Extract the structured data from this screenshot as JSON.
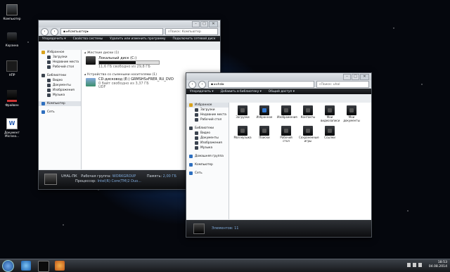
{
  "desktop": {
    "icons": [
      {
        "label": "Компьютер",
        "icon": "computer-icon"
      },
      {
        "label": "Корзина",
        "icon": "recycle-bin-icon"
      },
      {
        "label": "НПР",
        "icon": "shortcut-icon"
      },
      {
        "label": "Фрайвен",
        "icon": "shortcut-icon"
      },
      {
        "label": "Документ Microso...",
        "icon": "word-document-icon"
      }
    ]
  },
  "win1": {
    "path": "Компьютер",
    "search_placeholder": "Поиск: Компьютер",
    "toolbar": [
      "Упорядочить ▾",
      "Свойства системы",
      "Удалить или изменить программу",
      "Подключить сетевой диск"
    ],
    "nav": [
      {
        "label": "Избранное",
        "icon": "star-icon",
        "sub": false
      },
      {
        "label": "Загрузки",
        "icon": "folder-icon",
        "sub": true
      },
      {
        "label": "Недавние места",
        "icon": "folder-icon",
        "sub": true
      },
      {
        "label": "Рабочий стол",
        "icon": "folder-icon",
        "sub": true
      },
      {
        "label": "Библиотеки",
        "icon": "library-icon",
        "sub": false
      },
      {
        "label": "Видео",
        "icon": "folder-icon",
        "sub": true
      },
      {
        "label": "Документы",
        "icon": "folder-icon",
        "sub": true
      },
      {
        "label": "Изображения",
        "icon": "folder-icon",
        "sub": true
      },
      {
        "label": "Музыка",
        "icon": "folder-icon",
        "sub": true
      },
      {
        "label": "Компьютер",
        "icon": "computer-icon",
        "sub": false,
        "selected": true
      },
      {
        "label": "Сеть",
        "icon": "network-icon",
        "sub": false
      }
    ],
    "hdd_group": "▴ Жесткие диски (1)",
    "hdd_name": "Локальный диск (C:)",
    "hdd_free": "11,6 ГБ свободно из 29,8 ГБ",
    "hdd_used_fraction": 0.61,
    "rem_group": "▴ Устройства со съемными носителями (1)",
    "dvd_name": "CD-дисковод (E:) GRMSHSxFRER_RU_DVD",
    "dvd_free": "0 байт свободно из 3,37 ГБ",
    "dvd_fs": "UDF",
    "status": {
      "name": "UHAL-ПК",
      "wg_label": "Рабочая группа:",
      "wg": "WORKGROUP",
      "mem_label": "Память:",
      "mem": "2,00 ГБ",
      "cpu_label": "Процессор:",
      "cpu": "Intel(R) Core(TM)2 Duo..."
    }
  },
  "win2": {
    "path": "uhal",
    "search_placeholder": "Поиск: uhal",
    "toolbar": [
      "Упорядочить ▾",
      "Добавить в библиотеку ▾",
      "Общий доступ ▾"
    ],
    "nav": [
      {
        "label": "Избранное",
        "icon": "star-icon",
        "sub": false,
        "selected": true
      },
      {
        "label": "Загрузки",
        "icon": "folder-icon",
        "sub": true
      },
      {
        "label": "Недавние места",
        "icon": "folder-icon",
        "sub": true
      },
      {
        "label": "Рабочий стол",
        "icon": "folder-icon",
        "sub": true
      },
      {
        "label": "Библиотеки",
        "icon": "library-icon",
        "sub": false
      },
      {
        "label": "Видео",
        "icon": "folder-icon",
        "sub": true
      },
      {
        "label": "Документы",
        "icon": "folder-icon",
        "sub": true
      },
      {
        "label": "Изображения",
        "icon": "folder-icon",
        "sub": true
      },
      {
        "label": "Музыка",
        "icon": "folder-icon",
        "sub": true
      },
      {
        "label": "Домашняя группа",
        "icon": "homegroup-icon",
        "sub": false
      },
      {
        "label": "Компьютер",
        "icon": "computer-icon",
        "sub": false
      },
      {
        "label": "Сеть",
        "icon": "network-icon",
        "sub": false
      }
    ],
    "folders": [
      {
        "label": "Загрузки",
        "icon": "downloads-folder-icon"
      },
      {
        "label": "Избранное",
        "icon": "favorites-folder-icon"
      },
      {
        "label": "Изображения",
        "icon": "pictures-folder-icon"
      },
      {
        "label": "Контакты",
        "icon": "contacts-folder-icon"
      },
      {
        "label": "Мои видеозаписи",
        "icon": "videos-folder-icon"
      },
      {
        "label": "Мои документы",
        "icon": "documents-folder-icon"
      },
      {
        "label": "Моя музыка",
        "icon": "music-folder-icon"
      },
      {
        "label": "Поиски",
        "icon": "searches-folder-icon"
      },
      {
        "label": "Рабочий стол",
        "icon": "desktop-folder-icon"
      },
      {
        "label": "Сохраненные игры",
        "icon": "saved-games-folder-icon"
      },
      {
        "label": "Ссылки",
        "icon": "links-folder-icon"
      }
    ],
    "status": "Элементов: 11"
  },
  "taskbar": {
    "time": "18:53",
    "date": "04.08.2014"
  }
}
